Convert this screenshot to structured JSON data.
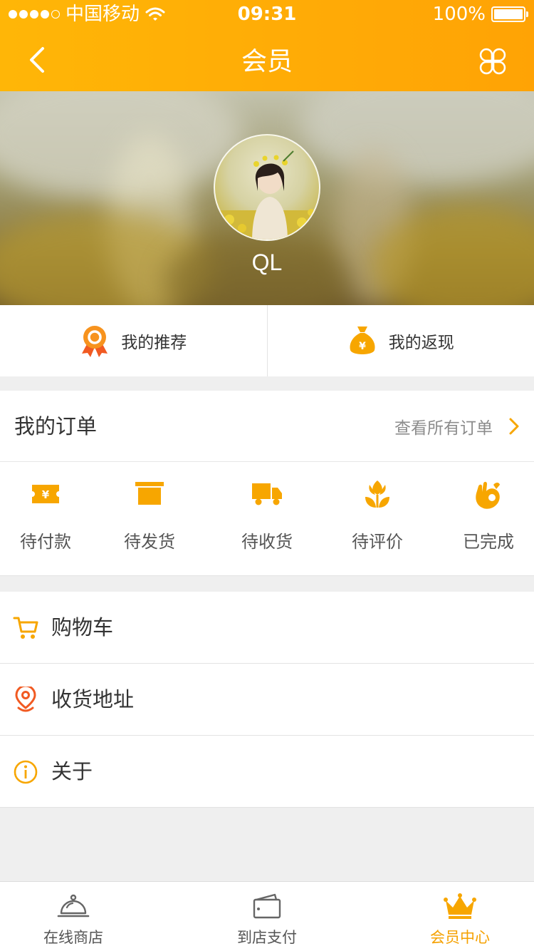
{
  "status_bar": {
    "carrier": "中国移动",
    "time": "09:31",
    "battery": "100%"
  },
  "nav": {
    "title": "会员"
  },
  "profile": {
    "username": "QL"
  },
  "quick_actions": [
    {
      "label": "我的推荐",
      "icon": "ribbon-badge-icon"
    },
    {
      "label": "我的返现",
      "icon": "money-bag-icon"
    }
  ],
  "orders": {
    "title": "我的订单",
    "view_all": "查看所有订单",
    "statuses": [
      {
        "label": "待付款",
        "icon": "ticket-yen-icon"
      },
      {
        "label": "待发货",
        "icon": "box-icon"
      },
      {
        "label": "待收货",
        "icon": "truck-icon"
      },
      {
        "label": "待评价",
        "icon": "flower-icon"
      },
      {
        "label": "已完成",
        "icon": "ok-hand-icon"
      }
    ]
  },
  "menu": [
    {
      "label": "购物车",
      "icon": "cart-icon"
    },
    {
      "label": "收货地址",
      "icon": "location-pin-icon"
    },
    {
      "label": "关于",
      "icon": "info-icon"
    }
  ],
  "tabs": [
    {
      "label": "在线商店",
      "icon": "cloche-icon",
      "active": false
    },
    {
      "label": "到店支付",
      "icon": "wallet-icon",
      "active": false
    },
    {
      "label": "会员中心",
      "icon": "crown-icon",
      "active": true
    }
  ],
  "colors": {
    "accent": "#ffa305",
    "icon_orange": "#f7a600",
    "icon_red": "#f15a22",
    "active_tab": "#f5a100"
  }
}
